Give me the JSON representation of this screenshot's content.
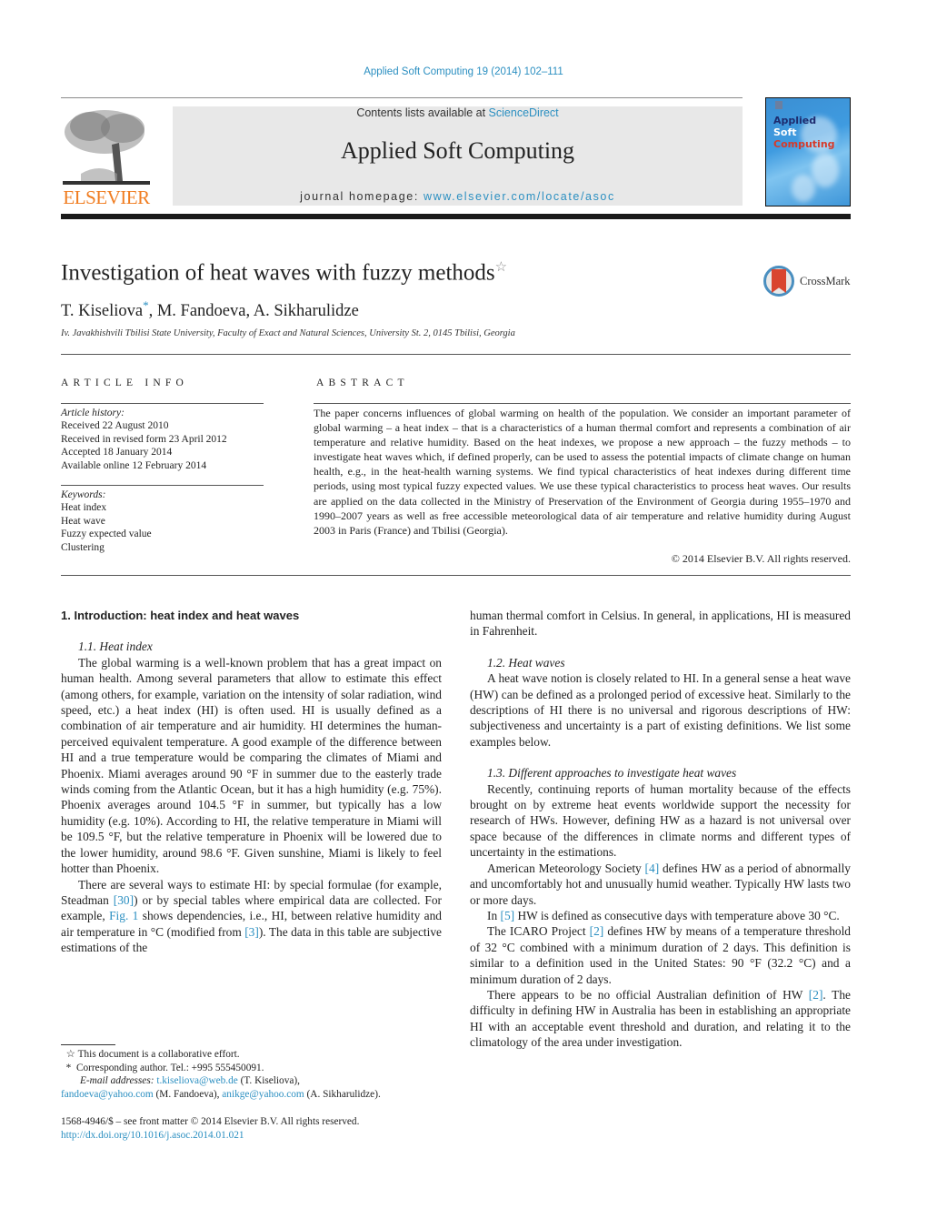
{
  "header": {
    "citation": "Applied Soft Computing 19 (2014) 102–111",
    "contents_prefix": "Contents lists available at ",
    "contents_link": "ScienceDirect",
    "journal_title": "Applied Soft Computing",
    "homepage_prefix": "journal homepage: ",
    "homepage_link": "www.elsevier.com/locate/asoc",
    "publisher_logo_text": "ELSEVIER",
    "cover": {
      "line1": "Applied",
      "line2": "Soft",
      "line3": "Computing"
    },
    "colors": {
      "link": "#2b8fc1",
      "elsevier_orange": "#f07d21",
      "masthead_bg": "#e8e8e8"
    }
  },
  "article": {
    "title": "Investigation of heat waves with fuzzy methods",
    "title_footnote_mark": "☆",
    "crossmark_label": "CrossMark",
    "authors": [
      {
        "name": "T. Kiseliova",
        "mark": "*"
      },
      {
        "name": "M. Fandoeva",
        "mark": ""
      },
      {
        "name": "A. Sikharulidze",
        "mark": ""
      }
    ],
    "affiliation": "Iv. Javakhishvili Tbilisi State University, Faculty of Exact and Natural Sciences, University St. 2, 0145 Tbilisi, Georgia"
  },
  "article_info": {
    "heading": "ARTICLE INFO",
    "history_label": "Article history:",
    "history": [
      "Received 22 August 2010",
      "Received in revised form 23 April 2012",
      "Accepted 18 January 2014",
      "Available online 12 February 2014"
    ],
    "keywords_label": "Keywords:",
    "keywords": [
      "Heat index",
      "Heat wave",
      "Fuzzy expected value",
      "Clustering"
    ]
  },
  "abstract": {
    "heading": "ABSTRACT",
    "text": "The paper concerns influences of global warming on health of the population. We consider an important parameter of global warming – a heat index – that is a characteristics of a human thermal comfort and represents a combination of air temperature and relative humidity. Based on the heat indexes, we propose a new approach – the fuzzy methods – to investigate heat waves which, if defined properly, can be used to assess the potential impacts of climate change on human health, e.g., in the heat-health warning systems. We find typical characteristics of heat indexes during different time periods, using most typical fuzzy expected values. We use these typical characteristics to process heat waves. Our results are applied on the data collected in the Ministry of Preservation of the Environment of Georgia during 1955–1970 and 1990–2007 years as well as free accessible meteorological data of air temperature and relative humidity during August 2003 in Paris (France) and Tbilisi (Georgia).",
    "copyright": "© 2014 Elsevier B.V. All rights reserved."
  },
  "body": {
    "section1_heading": "1.  Introduction: heat index and heat waves",
    "sub11_heading": "1.1.  Heat index",
    "p1": "The global warming is a well-known problem that has a great impact on human health. Among several parameters that allow to estimate this effect (among others, for example, variation on the intensity of solar radiation, wind speed, etc.) a heat index (HI) is often used. HI is usually defined as a combination of air temperature and air humidity. HI determines the human-perceived equivalent temperature. A good example of the difference between HI and a true temperature would be comparing the climates of Miami and Phoenix. Miami averages around 90 °F in summer due to the easterly trade winds coming from the Atlantic Ocean, but it has a high humidity (e.g. 75%). Phoenix averages around 104.5 °F in summer, but typically has a low humidity (e.g. 10%). According to HI, the relative temperature in Miami will be 109.5 °F, but the relative temperature in Phoenix will be lowered due to the lower humidity, around 98.6 °F. Given sunshine, Miami is likely to feel hotter than Phoenix.",
    "p2_a": "There are several ways to estimate HI: by special formulae (for example, Steadman ",
    "p2_ref1": "[30]",
    "p2_b": ") or by special tables where empirical data are collected. For example, ",
    "p2_ref2": "Fig. 1",
    "p2_c": " shows dependencies, i.e., HI, between relative humidity and air temperature in °C (modified from ",
    "p2_ref3": "[3]",
    "p2_d": "). The data in this table are subjective estimations of the",
    "p2_cont": "human thermal comfort in Celsius. In general, in applications, HI is measured in Fahrenheit.",
    "sub12_heading": "1.2.  Heat waves",
    "p3": "A heat wave notion is closely related to HI. In a general sense a heat wave (HW) can be defined as a prolonged period of excessive heat. Similarly to the descriptions of HI there is no universal and rigorous descriptions of HW: subjectiveness and uncertainty is a part of existing definitions. We list some examples below.",
    "sub13_heading": "1.3.  Different approaches to investigate heat waves",
    "p4": "Recently, continuing reports of human mortality because of the effects brought on by extreme heat events worldwide support the necessity for research of HWs. However, defining HW as a hazard is not universal over space because of the differences in climate norms and different types of uncertainty in the estimations.",
    "p5_a": "American Meteorology Society ",
    "p5_ref": "[4]",
    "p5_b": " defines HW as a period of abnormally and uncomfortably hot and unusually humid weather. Typically HW lasts two or more days.",
    "p6_a": "In ",
    "p6_ref": "[5]",
    "p6_b": " HW is defined as consecutive days with temperature above 30 °C.",
    "p7_a": "The ICARO Project ",
    "p7_ref": "[2]",
    "p7_b": " defines HW by means of a temperature threshold of 32 °C combined with a minimum duration of 2 days. This definition is similar to a definition used in the United States: 90 °F (32.2 °C) and a minimum duration of 2 days.",
    "p8_a": "There appears to be no official Australian definition of HW ",
    "p8_ref": "[2]",
    "p8_b": ". The difficulty in defining HW in Australia has been in establishing an appropriate HI with an acceptable event threshold and duration, and relating it to the climatology of the area under investigation."
  },
  "footnotes": {
    "star_mark": "☆",
    "star_text": "This document is a collaborative effort.",
    "asterisk_mark": "*",
    "corresponding": "Corresponding author. Tel.: +995 555450091.",
    "email_label": "E-mail addresses:",
    "emails": [
      {
        "address": "t.kiseliova@web.de",
        "owner": " (T. Kiseliova),"
      },
      {
        "address": "fandoeva@yahoo.com",
        "owner": " (M. Fandoeva), "
      },
      {
        "address": "anikge@yahoo.com",
        "owner": " (A. Sikharulidze)."
      }
    ],
    "front_matter": "1568-4946/$ – see front matter © 2014 Elsevier B.V. All rights reserved.",
    "doi": "http://dx.doi.org/10.1016/j.asoc.2014.01.021"
  }
}
